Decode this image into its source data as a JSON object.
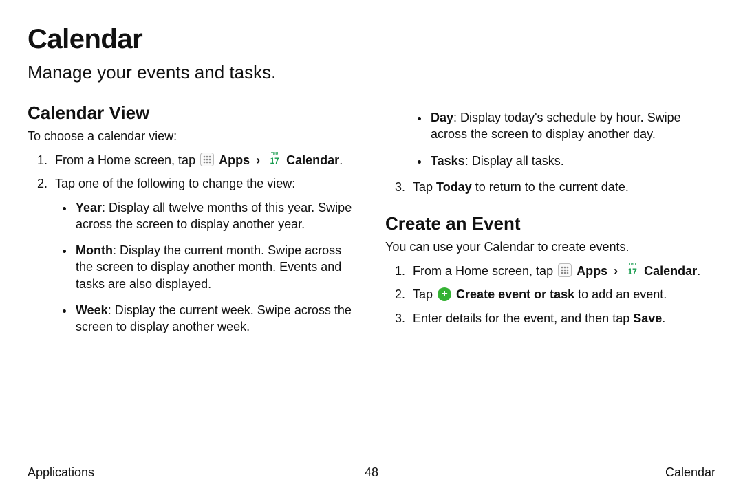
{
  "title": "Calendar",
  "subtitle": "Manage your events and tasks.",
  "section_view": "Calendar View",
  "view_intro": "To choose a calendar view:",
  "step1_pre": "From a Home screen, tap",
  "apps_label": "Apps",
  "chevron": "›",
  "calendar_label": "Calendar",
  "period": ".",
  "step2": "Tap one of the following to change the view:",
  "year_b": "Year",
  "year_t": ": Display all twelve months of this year. Swipe across the screen to display another year.",
  "month_b": "Month",
  "month_t": ": Display the current month. Swipe across the screen to display another month. Events and tasks are also displayed.",
  "week_b": "Week",
  "week_t": ": Display the current week. Swipe across the screen to display another week.",
  "day_b": "Day",
  "day_t": ": Display today's schedule by hour. Swipe across the screen to display another day.",
  "tasks_b": "Tasks",
  "tasks_t": ": Display all tasks.",
  "step3a": "Tap ",
  "today_b": "Today",
  "step3b": " to return to the current date.",
  "section_create": "Create an Event",
  "create_intro": "You can use your Calendar to create events.",
  "create2a": "Tap ",
  "create2b": "Create event or task",
  "create2c": " to add an event.",
  "create3a": "Enter details for the event, and then tap ",
  "save_b": "Save",
  "footer_left": "Applications",
  "footer_page": "48",
  "footer_right": "Calendar",
  "cal_top": "THU",
  "cal_num": "17",
  "plus": "+"
}
